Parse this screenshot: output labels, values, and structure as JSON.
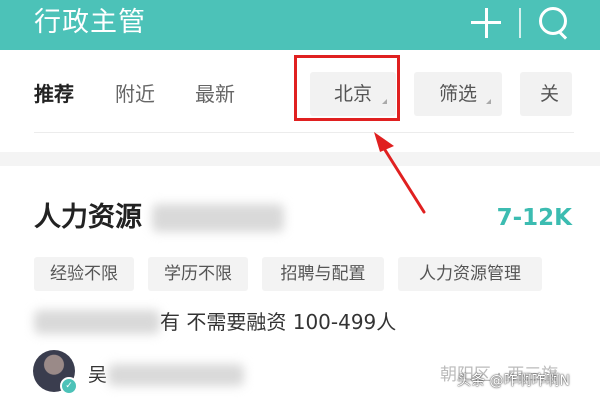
{
  "header": {
    "title": "行政主管",
    "icons": [
      "plus-icon",
      "search-icon"
    ],
    "background_color": "#4cc2b8"
  },
  "filters": {
    "tabs": [
      {
        "label": "推荐",
        "active": true
      },
      {
        "label": "附近",
        "active": false
      },
      {
        "label": "最新",
        "active": false
      }
    ],
    "chips": [
      {
        "label": "北京"
      },
      {
        "label": "筛选"
      },
      {
        "label": "关键"
      }
    ]
  },
  "annotation": {
    "highlight_color": "#e02020",
    "target": "北京"
  },
  "job": {
    "title": "人力资源",
    "salary": "7-12K",
    "salary_color": "#3cbcb1",
    "tags": [
      "经验不限",
      "学历不限",
      "招聘与配置",
      "人力资源管理"
    ],
    "company_info": "有 不需要融资 100-499人",
    "recruiter_name": "吴",
    "location": "朝阳区 · 西三旗"
  },
  "watermark": "头条 @咋啊咋啊N"
}
